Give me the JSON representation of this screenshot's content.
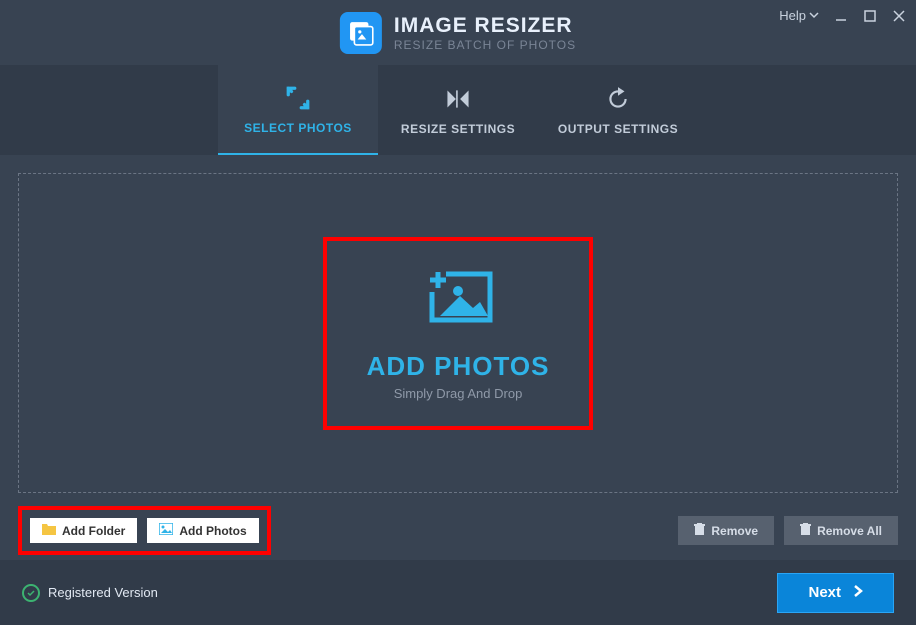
{
  "header": {
    "title": "IMAGE RESIZER",
    "subtitle": "RESIZE BATCH OF PHOTOS",
    "help_label": "Help"
  },
  "tabs": [
    {
      "label": "SELECT PHOTOS",
      "active": true
    },
    {
      "label": "RESIZE SETTINGS",
      "active": false
    },
    {
      "label": "OUTPUT SETTINGS",
      "active": false
    }
  ],
  "dropzone": {
    "title": "ADD PHOTOS",
    "subtitle": "Simply Drag And Drop"
  },
  "buttons": {
    "add_folder": "Add Folder",
    "add_photos": "Add Photos",
    "remove": "Remove",
    "remove_all": "Remove All"
  },
  "footer": {
    "status": "Registered Version",
    "next_label": "Next"
  },
  "colors": {
    "accent": "#2fb3e8",
    "highlight": "#ff0000",
    "primary": "#0a85d9"
  }
}
